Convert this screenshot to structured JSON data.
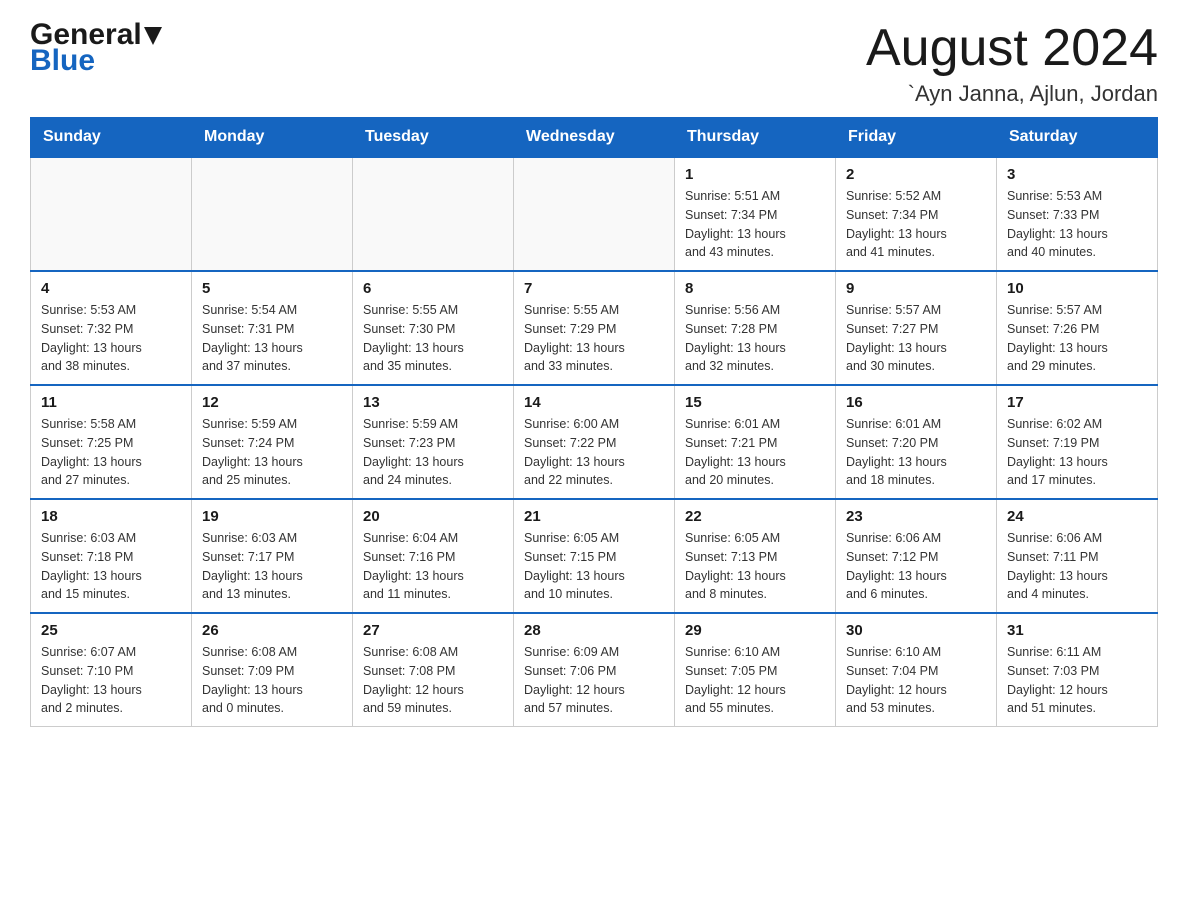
{
  "header": {
    "logo_general": "General",
    "logo_blue": "Blue",
    "month_year": "August 2024",
    "location": "`Ayn Janna, Ajlun, Jordan"
  },
  "weekdays": [
    "Sunday",
    "Monday",
    "Tuesday",
    "Wednesday",
    "Thursday",
    "Friday",
    "Saturday"
  ],
  "weeks": [
    [
      {
        "day": "",
        "info": ""
      },
      {
        "day": "",
        "info": ""
      },
      {
        "day": "",
        "info": ""
      },
      {
        "day": "",
        "info": ""
      },
      {
        "day": "1",
        "info": "Sunrise: 5:51 AM\nSunset: 7:34 PM\nDaylight: 13 hours\nand 43 minutes."
      },
      {
        "day": "2",
        "info": "Sunrise: 5:52 AM\nSunset: 7:34 PM\nDaylight: 13 hours\nand 41 minutes."
      },
      {
        "day": "3",
        "info": "Sunrise: 5:53 AM\nSunset: 7:33 PM\nDaylight: 13 hours\nand 40 minutes."
      }
    ],
    [
      {
        "day": "4",
        "info": "Sunrise: 5:53 AM\nSunset: 7:32 PM\nDaylight: 13 hours\nand 38 minutes."
      },
      {
        "day": "5",
        "info": "Sunrise: 5:54 AM\nSunset: 7:31 PM\nDaylight: 13 hours\nand 37 minutes."
      },
      {
        "day": "6",
        "info": "Sunrise: 5:55 AM\nSunset: 7:30 PM\nDaylight: 13 hours\nand 35 minutes."
      },
      {
        "day": "7",
        "info": "Sunrise: 5:55 AM\nSunset: 7:29 PM\nDaylight: 13 hours\nand 33 minutes."
      },
      {
        "day": "8",
        "info": "Sunrise: 5:56 AM\nSunset: 7:28 PM\nDaylight: 13 hours\nand 32 minutes."
      },
      {
        "day": "9",
        "info": "Sunrise: 5:57 AM\nSunset: 7:27 PM\nDaylight: 13 hours\nand 30 minutes."
      },
      {
        "day": "10",
        "info": "Sunrise: 5:57 AM\nSunset: 7:26 PM\nDaylight: 13 hours\nand 29 minutes."
      }
    ],
    [
      {
        "day": "11",
        "info": "Sunrise: 5:58 AM\nSunset: 7:25 PM\nDaylight: 13 hours\nand 27 minutes."
      },
      {
        "day": "12",
        "info": "Sunrise: 5:59 AM\nSunset: 7:24 PM\nDaylight: 13 hours\nand 25 minutes."
      },
      {
        "day": "13",
        "info": "Sunrise: 5:59 AM\nSunset: 7:23 PM\nDaylight: 13 hours\nand 24 minutes."
      },
      {
        "day": "14",
        "info": "Sunrise: 6:00 AM\nSunset: 7:22 PM\nDaylight: 13 hours\nand 22 minutes."
      },
      {
        "day": "15",
        "info": "Sunrise: 6:01 AM\nSunset: 7:21 PM\nDaylight: 13 hours\nand 20 minutes."
      },
      {
        "day": "16",
        "info": "Sunrise: 6:01 AM\nSunset: 7:20 PM\nDaylight: 13 hours\nand 18 minutes."
      },
      {
        "day": "17",
        "info": "Sunrise: 6:02 AM\nSunset: 7:19 PM\nDaylight: 13 hours\nand 17 minutes."
      }
    ],
    [
      {
        "day": "18",
        "info": "Sunrise: 6:03 AM\nSunset: 7:18 PM\nDaylight: 13 hours\nand 15 minutes."
      },
      {
        "day": "19",
        "info": "Sunrise: 6:03 AM\nSunset: 7:17 PM\nDaylight: 13 hours\nand 13 minutes."
      },
      {
        "day": "20",
        "info": "Sunrise: 6:04 AM\nSunset: 7:16 PM\nDaylight: 13 hours\nand 11 minutes."
      },
      {
        "day": "21",
        "info": "Sunrise: 6:05 AM\nSunset: 7:15 PM\nDaylight: 13 hours\nand 10 minutes."
      },
      {
        "day": "22",
        "info": "Sunrise: 6:05 AM\nSunset: 7:13 PM\nDaylight: 13 hours\nand 8 minutes."
      },
      {
        "day": "23",
        "info": "Sunrise: 6:06 AM\nSunset: 7:12 PM\nDaylight: 13 hours\nand 6 minutes."
      },
      {
        "day": "24",
        "info": "Sunrise: 6:06 AM\nSunset: 7:11 PM\nDaylight: 13 hours\nand 4 minutes."
      }
    ],
    [
      {
        "day": "25",
        "info": "Sunrise: 6:07 AM\nSunset: 7:10 PM\nDaylight: 13 hours\nand 2 minutes."
      },
      {
        "day": "26",
        "info": "Sunrise: 6:08 AM\nSunset: 7:09 PM\nDaylight: 13 hours\nand 0 minutes."
      },
      {
        "day": "27",
        "info": "Sunrise: 6:08 AM\nSunset: 7:08 PM\nDaylight: 12 hours\nand 59 minutes."
      },
      {
        "day": "28",
        "info": "Sunrise: 6:09 AM\nSunset: 7:06 PM\nDaylight: 12 hours\nand 57 minutes."
      },
      {
        "day": "29",
        "info": "Sunrise: 6:10 AM\nSunset: 7:05 PM\nDaylight: 12 hours\nand 55 minutes."
      },
      {
        "day": "30",
        "info": "Sunrise: 6:10 AM\nSunset: 7:04 PM\nDaylight: 12 hours\nand 53 minutes."
      },
      {
        "day": "31",
        "info": "Sunrise: 6:11 AM\nSunset: 7:03 PM\nDaylight: 12 hours\nand 51 minutes."
      }
    ]
  ]
}
